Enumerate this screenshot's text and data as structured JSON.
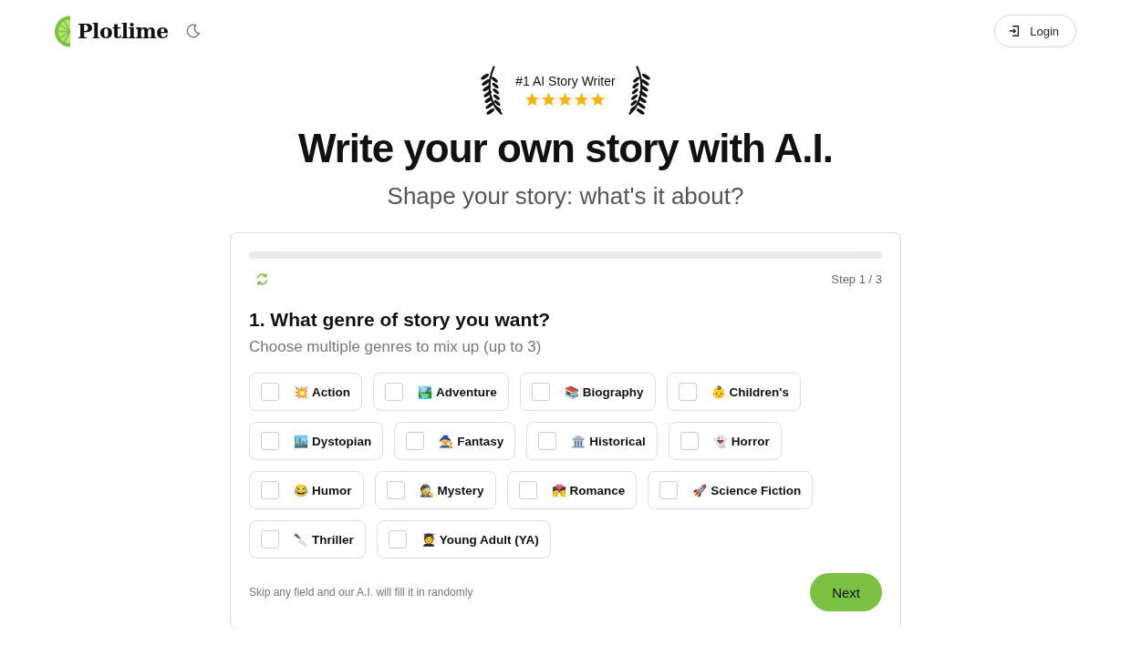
{
  "header": {
    "logo": "Plotlime",
    "login": "Login"
  },
  "badge": {
    "title": "#1 AI Story Writer",
    "stars": 5
  },
  "hero": {
    "title": "Write your own story with A.I.",
    "subtitle": "Shape your story: what's it about?"
  },
  "wizard": {
    "progress": {
      "level": 0
    },
    "step": "Step 1 / 3",
    "question": "1. What genre of story you want?",
    "hint": "Choose multiple genres to mix up (up to 3)",
    "genres": [
      {
        "emoji": "💥",
        "label": "Action",
        "checked": false
      },
      {
        "emoji": "🏞️",
        "label": "Adventure",
        "checked": false
      },
      {
        "emoji": "📚",
        "label": "Biography",
        "checked": false
      },
      {
        "emoji": "👶",
        "label": "Children's",
        "checked": false
      },
      {
        "emoji": "🏙️",
        "label": "Dystopian",
        "checked": false
      },
      {
        "emoji": "🧙",
        "label": "Fantasy",
        "checked": false
      },
      {
        "emoji": "🏛️",
        "label": "Historical",
        "checked": false
      },
      {
        "emoji": "👻",
        "label": "Horror",
        "checked": false
      },
      {
        "emoji": "😂",
        "label": "Humor",
        "checked": false
      },
      {
        "emoji": "🕵️",
        "label": "Mystery",
        "checked": false
      },
      {
        "emoji": "💏",
        "label": "Romance",
        "checked": false
      },
      {
        "emoji": "🚀",
        "label": "Science Fiction",
        "checked": false
      },
      {
        "emoji": "🔪",
        "label": "Thriller",
        "checked": false
      },
      {
        "emoji": "🧑‍🎓",
        "label": "Young Adult (YA)",
        "checked": false
      }
    ],
    "footer_note": "Skip any field and our A.I. will fill it in randomly",
    "next": "Next"
  }
}
